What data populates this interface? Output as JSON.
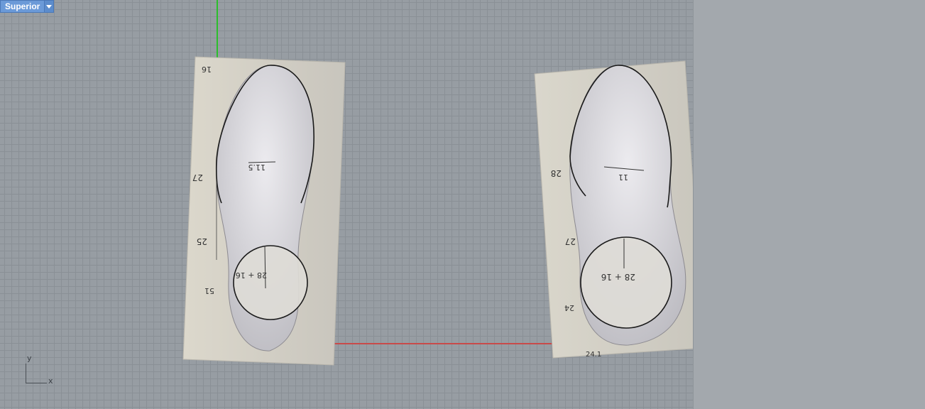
{
  "viewport": {
    "label": "Superior",
    "axis_labels": {
      "x": "x",
      "y": "y"
    }
  },
  "references": [
    {
      "marks": {
        "top": "16",
        "upper": "27",
        "middle": "25",
        "lower": "51",
        "center": "11.5",
        "circle": "28 + 16"
      }
    },
    {
      "marks": {
        "upper": "28",
        "middle": "27",
        "lower": "24",
        "center": "11",
        "circle": "28 + 16",
        "bottom": "24.1"
      }
    }
  ],
  "colors": {
    "viewport_bg": "#979da3",
    "grid": "#8a9096",
    "x_axis": "#c94a4a",
    "y_axis": "#2bbf2b",
    "tab_bg": "#6b9ad8"
  }
}
